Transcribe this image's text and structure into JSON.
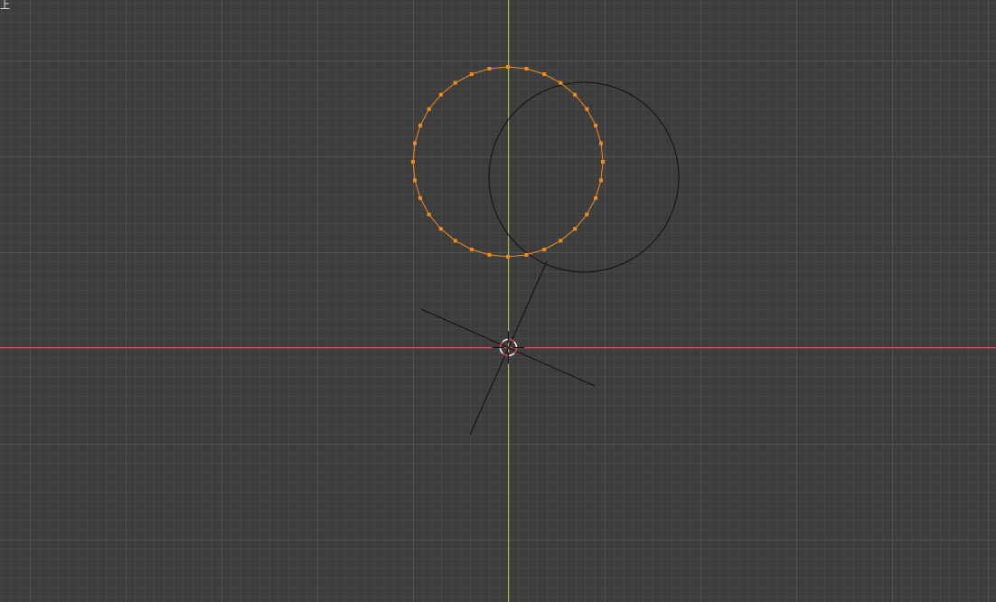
{
  "viewport": {
    "view_name": "上",
    "colors": {
      "background": "#3d3d3d",
      "grid_minor": "#474747",
      "grid_major": "#525252",
      "x_axis": "#d94b55",
      "y_axis": "#9ccc3f",
      "selected": "#f08c1e",
      "wire": "#101010",
      "cursor_red": "#e0424b",
      "cursor_white": "#f0f0f0"
    },
    "objects": [
      {
        "name": "circle-selected",
        "selected": true,
        "vertex_count": 32
      },
      {
        "name": "circle-unselected",
        "selected": false
      },
      {
        "name": "empty-axes",
        "selected": false
      }
    ]
  }
}
